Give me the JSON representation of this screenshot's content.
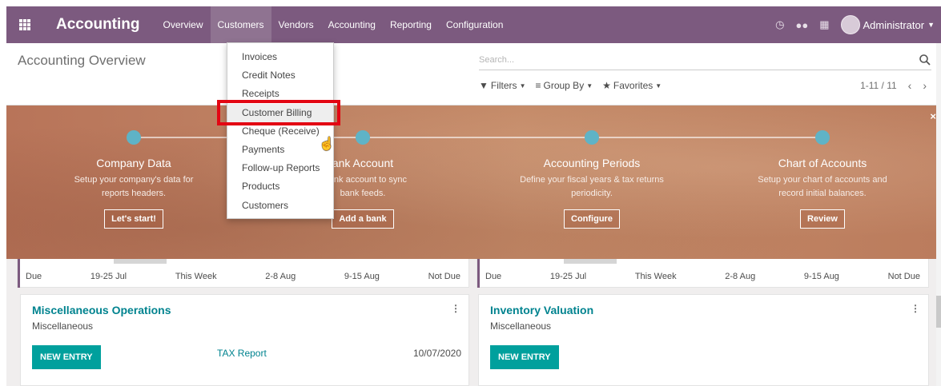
{
  "navbar": {
    "brand": "Accounting",
    "menu": [
      "Overview",
      "Customers",
      "Vendors",
      "Accounting",
      "Reporting",
      "Configuration"
    ],
    "active_menu": "Customers",
    "user": "Administrator",
    "bg_color": "#7c5a7f"
  },
  "control": {
    "title": "Accounting Overview",
    "search_placeholder": "Search...",
    "filters_label": "Filters",
    "groupby_label": "Group By",
    "favorites_label": "Favorites",
    "pager_text": "1-11 / 11"
  },
  "dropdown": {
    "items": [
      "Invoices",
      "Credit Notes",
      "Receipts",
      "Customer Billing",
      "Cheque (Receive)",
      "Payments",
      "Follow-up Reports",
      "Products",
      "Customers"
    ],
    "hovered": "Customer Billing"
  },
  "banner": {
    "steps": [
      {
        "title": "Company Data",
        "desc1": "Setup your company's data for",
        "desc2": "reports headers.",
        "button": "Let's start!"
      },
      {
        "title": "ank Account",
        "desc1": "r bank account to sync",
        "desc2": "bank feeds.",
        "button": "Add a bank"
      },
      {
        "title": "Accounting Periods",
        "desc1": "Define your fiscal years & tax returns",
        "desc2": "periodicity.",
        "button": "Configure"
      },
      {
        "title": "Chart of Accounts",
        "desc1": "Setup your chart of accounts and",
        "desc2": "record initial balances.",
        "button": "Review"
      }
    ]
  },
  "graph_ticks": [
    "Due",
    "19-25 Jul",
    "This Week",
    "2-8 Aug",
    "9-15 Aug",
    "Not Due"
  ],
  "journals": [
    {
      "title": "Miscellaneous Operations",
      "subtitle": "Miscellaneous",
      "button": "NEW ENTRY",
      "link": "TAX Report",
      "date": "10/07/2020"
    },
    {
      "title": "Inventory Valuation",
      "subtitle": "Miscellaneous",
      "button": "NEW ENTRY"
    }
  ]
}
